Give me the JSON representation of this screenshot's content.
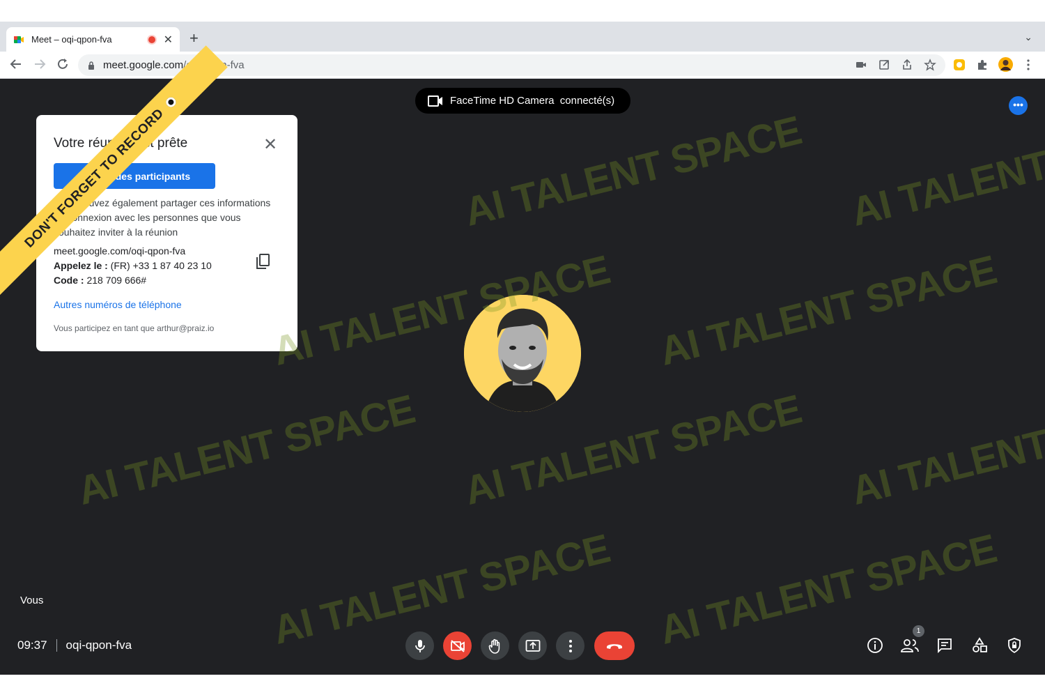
{
  "browser": {
    "tab_title": "Meet – oqi-qpon-fva",
    "new_tab": "+",
    "tab_close": "✕",
    "tab_menu": "⌄",
    "url_host": "meet.google.com",
    "url_path": "/oqi-qpon-fva"
  },
  "meet": {
    "camera_pill": "FaceTime HD Camera  connecté(s)",
    "more_options": "•••",
    "self_label": "Vous",
    "time": "09:37",
    "meeting_code": "oqi-qpon-fva",
    "participant_count": "1"
  },
  "card": {
    "title": "Votre réunion est prête",
    "close": "✕",
    "add_button": "Ajouter des participants",
    "description": "Vous pouvez également partager ces informations de connexion avec les personnes que vous souhaitez inviter à la réunion",
    "link": "meet.google.com/oqi-qpon-fva",
    "phone_label": "Appelez le :",
    "phone_value": " (FR) +33 1 87 40 23 10",
    "code_label": "Code :",
    "code_value": " 218 709 666#",
    "other_numbers": "Autres numéros de téléphone",
    "joined_as": "Vous participez en tant que arthur@praiz.io"
  },
  "overlay": {
    "ribbon_text": "DON'T FORGET TO RECORD",
    "watermark_text": "AI TALENT SPACE"
  },
  "colors": {
    "meet_bg": "#202124",
    "accent": "#1a73e8",
    "danger": "#ea4335",
    "ribbon": "#fcd34d"
  }
}
